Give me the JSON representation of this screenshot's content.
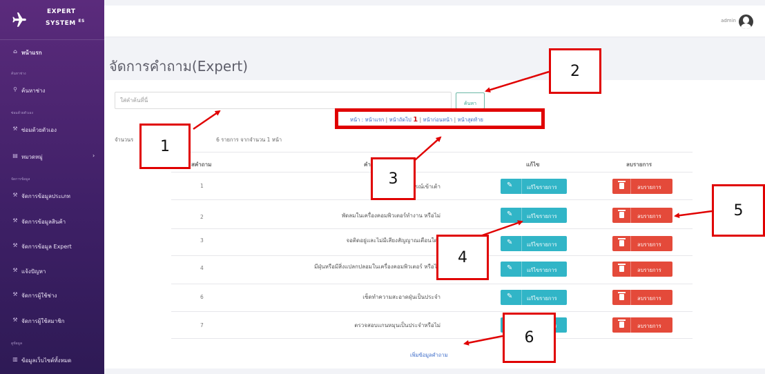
{
  "brand": {
    "line1": "EXPERT",
    "line2": "SYSTEM",
    "suffix": "ES"
  },
  "sidebar": {
    "home": "หน้าแรก",
    "section_1": "ค้นหาช่าง",
    "search": "ค้นหาช่าง",
    "section_2": "ซ่อมด้วยตัวเอง",
    "self_repair": "ซ่อมด้วยตัวเอง",
    "category": "หมวดหมู่",
    "section_3": "จัดการข้อมูล",
    "manage_type": "จัดการข้อมูลประเภท",
    "manage_product": "จัดการข้อมูลสินค้า",
    "manage_expert": "จัดการข้อมูล Expert",
    "report_problem": "แจ้งปัญหา",
    "manage_technician": "จัดการผู้ใช้ช่าง",
    "manage_member": "จัดการผู้ใช้สมาชิก",
    "section_4": "ดูข้อมูล",
    "all_website_data": "ข้อมูลเว็บไซต์ทั้งหมด"
  },
  "topbar": {
    "user": "admin"
  },
  "page": {
    "title": "จัดการคำถาม(Expert)"
  },
  "search": {
    "placeholder": "ใส่คำค้นที่นี่",
    "button": "ค้นหา"
  },
  "pager": {
    "prefix": "หน้า :",
    "first": "หน้าแรก",
    "next": "หน้าถัดไป",
    "current": "1",
    "prev": "หน้าก่อนหน้า",
    "last": "หน้าสุดท้าย"
  },
  "summary": {
    "start": "จำนวนร",
    "end": "6 รายการ จากจำนวน 1 หน้า"
  },
  "table": {
    "headers": [
      "สคำถาม",
      "คำถาม",
      "แก้ไข",
      "ลบรายการ"
    ],
    "rows": [
      {
        "id": "1",
        "question": "ต่อปลั๊กจากอุปกรณ์เข้าเต้า"
      },
      {
        "id": "2",
        "question": "พัดลมในเครื่องคอมพิวเตอร์ทำงาน หรือไม่"
      },
      {
        "id": "3",
        "question": "จอติดอยู่และไม่มีเสียงสัญญาณเตือนใดๆ"
      },
      {
        "id": "4",
        "question": "มีฝุ่นหรือมีสิ่งแปลกปลอมในเครื่องคอมพิวเตอร์ หรือไม่"
      },
      {
        "id": "6",
        "question": "เช็ดทำความสะอาดฝุ่นเป็นประจำ"
      },
      {
        "id": "7",
        "question": "ตรวจสอบแกนหมุนเป็นประจำหรือไม่"
      }
    ],
    "edit_label": "แก้ไขรายการ",
    "delete_label": "ลบรายการ"
  },
  "add_link": "เพิ่มข้อมูลคำถาม",
  "callouts": {
    "c1": "1",
    "c2": "2",
    "c3": "3",
    "c4": "4",
    "c5": "5",
    "c6": "6"
  },
  "colors": {
    "sidebar": "#4a2570",
    "edit": "#31b5c7",
    "delete": "#e44a3a",
    "annotation": "#e00000",
    "link": "#3a6ac8"
  },
  "icons": [
    "airplane-icon",
    "home-icon",
    "search-icon",
    "wrench-icon",
    "list-icon",
    "pencil-icon",
    "trash-icon",
    "user-avatar-icon"
  ]
}
